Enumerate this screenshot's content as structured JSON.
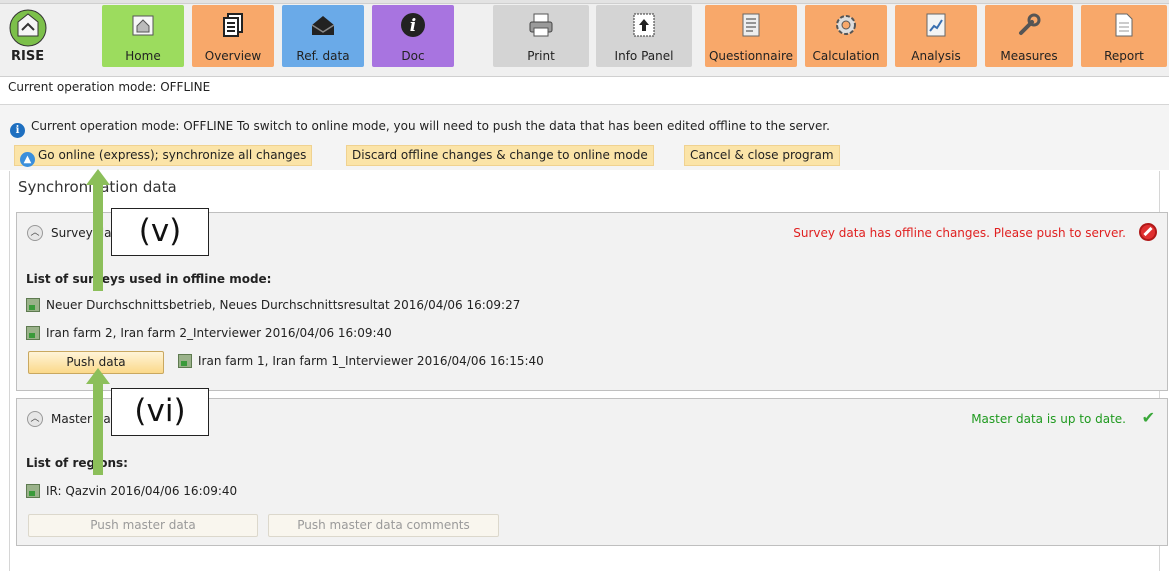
{
  "toolbar": {
    "logo_text": "RISE",
    "buttons": [
      {
        "label": "Home",
        "icon": "home-icon",
        "color": "#9cdc5e"
      },
      {
        "label": "Overview",
        "icon": "copy-icon",
        "color": "#f8a86a"
      },
      {
        "label": "Ref. data",
        "icon": "envelope-icon",
        "color": "#6aaae8"
      },
      {
        "label": "Doc",
        "icon": "info-icon",
        "color": "#a874e0"
      },
      {
        "label": "Print",
        "icon": "printer-icon",
        "color": "#d4d4d4"
      },
      {
        "label": "Info Panel",
        "icon": "info-panel-icon",
        "color": "#d4d4d4"
      },
      {
        "label": "Questionnaire",
        "icon": "questionnaire-icon",
        "color": "#f8a86a"
      },
      {
        "label": "Calculation",
        "icon": "gear-icon",
        "color": "#f8a86a"
      },
      {
        "label": "Analysis",
        "icon": "chart-icon",
        "color": "#f8a86a"
      },
      {
        "label": "Measures",
        "icon": "wrench-icon",
        "color": "#f8a86a"
      },
      {
        "label": "Report",
        "icon": "document-icon",
        "color": "#f8a86a"
      }
    ]
  },
  "mode_line": "Current operation mode: OFFLINE",
  "info_bar": {
    "text": "Current operation mode: OFFLINE  To switch to online mode, you will need to push the data that has been edited offline to the server.",
    "actions": [
      "Go online (express); synchronize all changes",
      "Discard offline changes & change to online mode",
      "Cancel & close program"
    ]
  },
  "main": {
    "title": "Synchronization data",
    "survey_panel": {
      "title": "Survey data",
      "status": "Survey data has offline changes. Please push to server.",
      "list_title": "List of surveys used in offline mode:",
      "items": [
        "Neuer Durchschnittsbetrieb, Neues Durchschnittsresultat  2016/04/06 16:09:27",
        "Iran farm 2, Iran farm 2_Interviewer   2016/04/06 16:09:40",
        "Iran farm 1, Iran farm 1_Interviewer  2016/04/06 16:15:40"
      ],
      "push_button": "Push data"
    },
    "master_panel": {
      "title": "Master data",
      "status": "Master data is up to date.",
      "list_title": "List of regions:",
      "items": [
        "IR: Qazvin  2016/04/06 16:09:40"
      ],
      "push_master_button": "Push master data",
      "push_comments_button": "Push master data comments"
    }
  },
  "annotations": {
    "label_v": "(v)",
    "label_vi": "(vi)",
    "arrow_color": "#8cbf5a"
  }
}
